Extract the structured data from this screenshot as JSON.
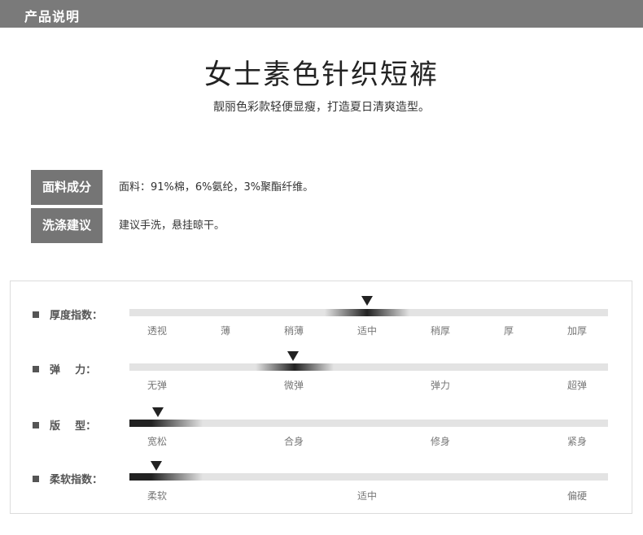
{
  "header": {
    "title": "产品说明"
  },
  "product": {
    "name": "女士素色针织短裤",
    "slogan": "靓丽色彩款轻便显瘦，打造夏日清爽造型。"
  },
  "info": [
    {
      "label": "面料成分",
      "value": "面料：91%棉，6%氨纶，3%聚酯纤维。"
    },
    {
      "label": "洗涤建议",
      "value": "建议手洗，悬挂晾干。"
    }
  ],
  "metrics": [
    {
      "label": "厚度指数：",
      "scale": [
        "透视",
        "薄",
        "稍薄",
        "适中",
        "稍厚",
        "厚",
        "加厚"
      ],
      "selected": "适中"
    },
    {
      "label": "弹    力：",
      "scale": [
        "无弹",
        "微弹",
        "弹力",
        "超弹"
      ],
      "selected": "微弹"
    },
    {
      "label": "版    型：",
      "scale": [
        "宽松",
        "合身",
        "修身",
        "紧身"
      ],
      "selected": "宽松"
    },
    {
      "label": "柔软指数：",
      "scale": [
        "柔软",
        "适中",
        "偏硬"
      ],
      "selected": "柔软"
    }
  ]
}
